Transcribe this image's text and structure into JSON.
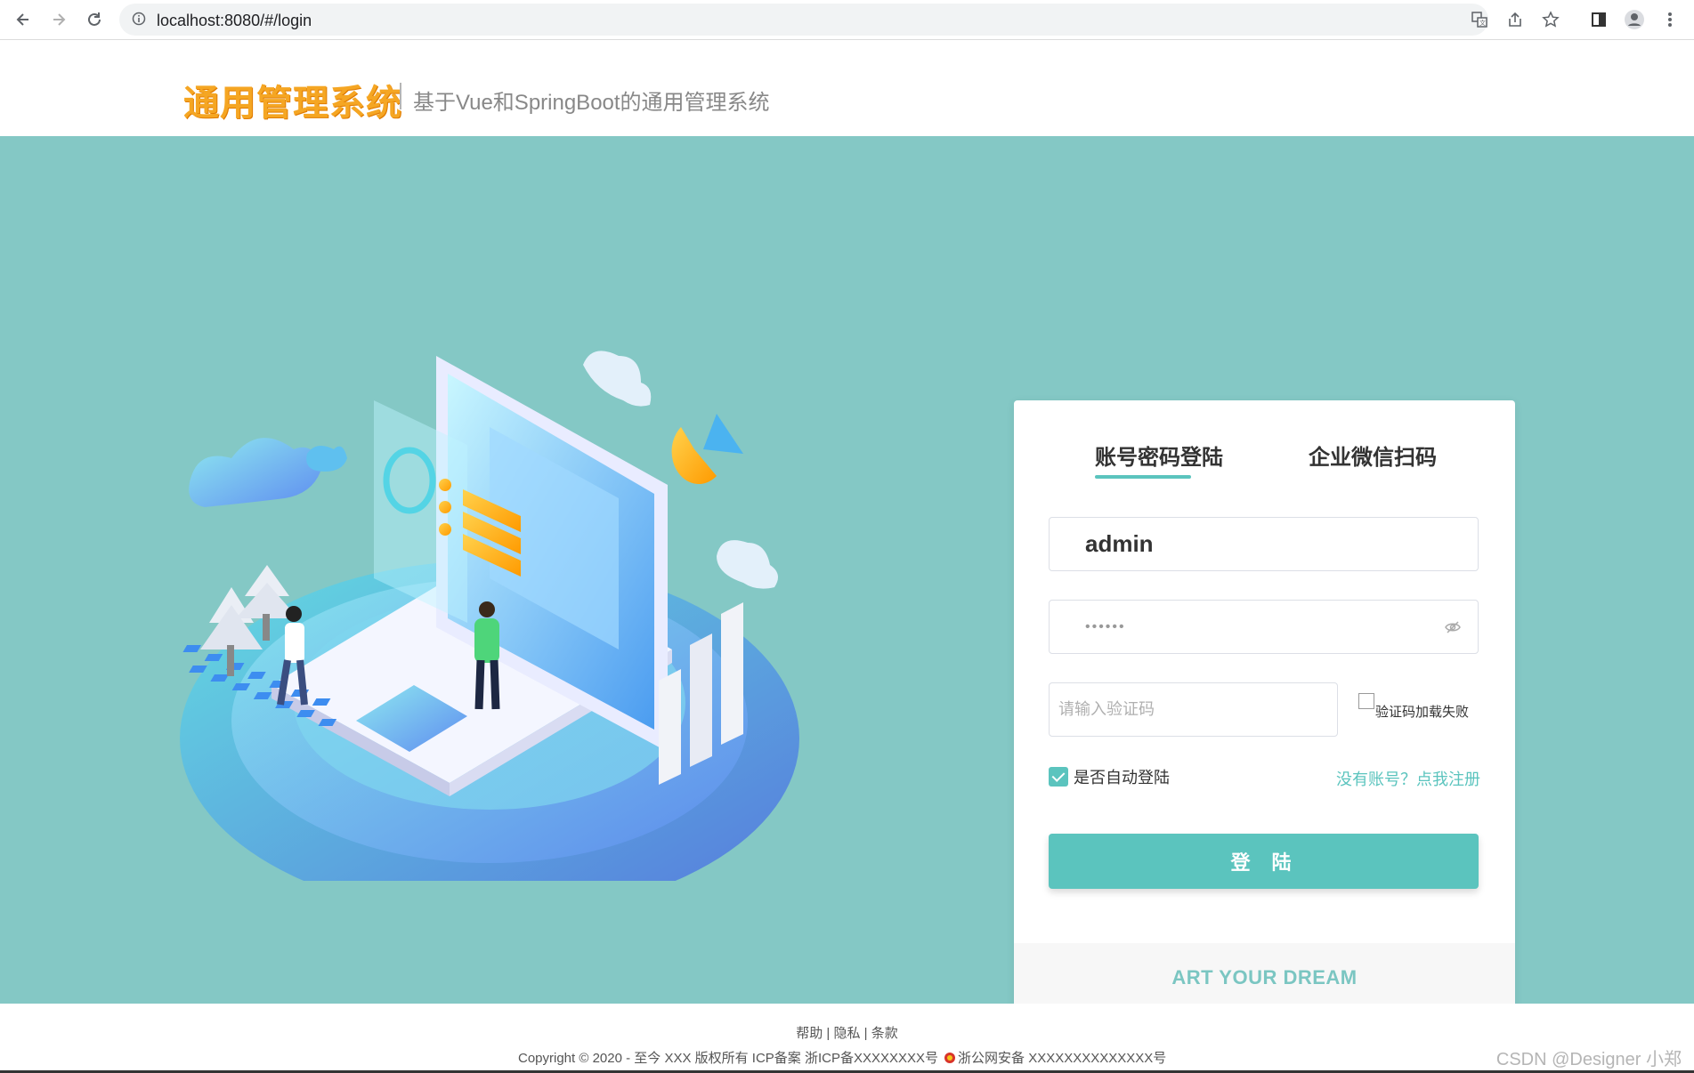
{
  "browser": {
    "url": "localhost:8080/#/login"
  },
  "header": {
    "logo_text": "通用管理系统",
    "subtitle": "基于Vue和SpringBoot的通用管理系统"
  },
  "login": {
    "tabs": [
      {
        "label": "账号密码登陆",
        "active": true
      },
      {
        "label": "企业微信扫码",
        "active": false
      }
    ],
    "username_value": "admin",
    "password_value": "••••••",
    "captcha_placeholder": "请输入验证码",
    "captcha_alt": "验证码加载失败",
    "remember_label": "是否自动登陆",
    "remember_checked": true,
    "register_link": "没有账号？点我注册",
    "submit_label": "登陆",
    "card_footer": "ART YOUR DREAM"
  },
  "footer": {
    "links": [
      "帮助",
      "隐私",
      "条款"
    ],
    "separator": " | ",
    "copyright": "Copyright © 2020 - 至今 XXX 版权所有 ICP备案 浙ICP备XXXXXXXX号",
    "police": "浙公网安备 XXXXXXXXXXXXXX号",
    "watermark": "CSDN @Designer 小郑"
  },
  "colors": {
    "main_bg": "#84c8c5",
    "accent": "#5bc4be",
    "logo": "#f5a623"
  },
  "icons": [
    "back-icon",
    "forward-icon",
    "reload-icon",
    "info-icon",
    "translate-icon",
    "share-icon",
    "star-icon",
    "sidepanel-icon",
    "profile-icon",
    "menu-icon",
    "eye-off-icon",
    "police-badge-icon"
  ]
}
